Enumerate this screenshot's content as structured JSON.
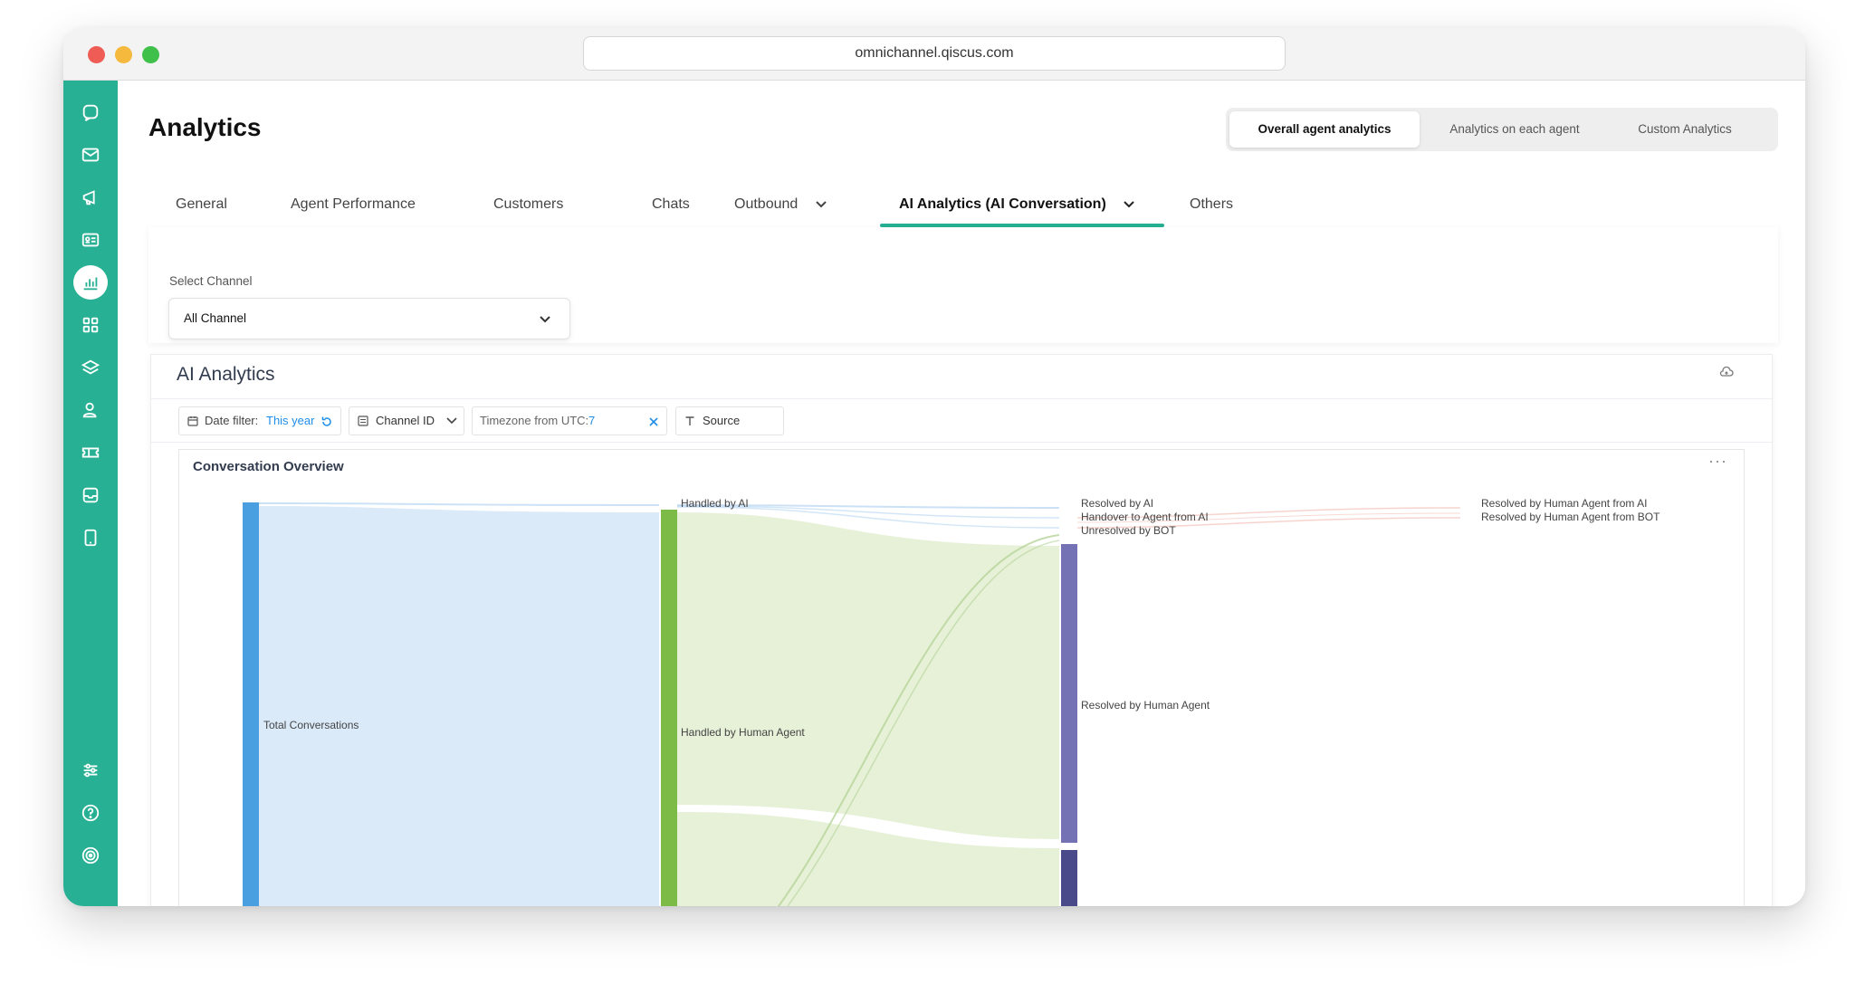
{
  "browser": {
    "url": "omnichannel.qiscus.com"
  },
  "sidebar": {
    "icons": [
      "chat-icon",
      "mail-icon",
      "megaphone-icon",
      "contact-card-icon",
      "analytics-icon",
      "apps-grid-icon",
      "layers-icon",
      "agent-icon",
      "ticket-icon",
      "inbox-icon",
      "mobile-icon",
      "settings-sliders-icon",
      "help-icon",
      "target-icon"
    ],
    "active": "analytics-icon"
  },
  "header": {
    "title": "Analytics",
    "views": [
      {
        "label": "Overall agent analytics",
        "active": true
      },
      {
        "label": "Analytics on each agent",
        "active": false
      },
      {
        "label": "Custom Analytics",
        "active": false
      }
    ]
  },
  "tabs": [
    {
      "label": "General"
    },
    {
      "label": "Agent Performance"
    },
    {
      "label": "Customers"
    },
    {
      "label": "Chats"
    },
    {
      "label": "Outbound",
      "has_dropdown": true
    },
    {
      "label": "AI Analytics (AI Conversation)",
      "has_dropdown": true,
      "active": true
    },
    {
      "label": "Others"
    }
  ],
  "channel": {
    "label": "Select Channel",
    "value": "All Channel"
  },
  "ai_analytics": {
    "title": "AI Analytics",
    "filters": {
      "date_label": "Date filter:",
      "date_value": "This year",
      "channel_id": "Channel ID",
      "timezone_label": "Timezone from UTC:",
      "timezone_value": "7",
      "source": "Source"
    },
    "overview_title": "Conversation Overview",
    "more_label": "···"
  },
  "colors": {
    "sidebar": "#27b093",
    "accent": "#27b093",
    "link": "#1f8ee8",
    "node_total": "#4a9fe0",
    "node_human": "#7dbb47",
    "node_resolved_human": "#7472b4",
    "node_dark": "#4a4a8a"
  },
  "chart_data": {
    "type": "sankey",
    "nodes": [
      "Total Conversations",
      "Handled by AI",
      "Handled by Human Agent",
      "Resolved by AI",
      "Handover to Agent from AI",
      "Unresolved by BOT",
      "Resolved by Human Agent",
      "Resolved by Human Agent from AI",
      "Resolved by Human Agent from BOT"
    ]
  }
}
